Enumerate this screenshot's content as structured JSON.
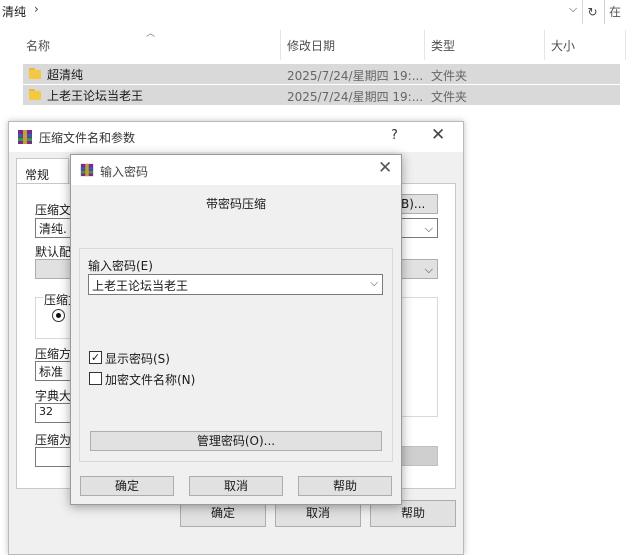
{
  "explorer": {
    "path": "清纯",
    "search_hint": "在",
    "columns": {
      "name": "名称",
      "modified": "修改日期",
      "type": "类型",
      "size": "大小"
    },
    "rows": [
      {
        "name": "超清纯",
        "modified": "2025/7/24/星期四 19:...",
        "type": "文件夹"
      },
      {
        "name": "上老王论坛当老王",
        "modified": "2025/7/24/星期四 19:...",
        "type": "文件夹"
      }
    ]
  },
  "back_dialog": {
    "title": "压缩文件名和参数",
    "help": "?",
    "tab": "常规",
    "archive_name_label": "压缩文",
    "archive_name_value": "清纯.",
    "browse_button_fragment": "B)...",
    "default_profile_label": "默认配",
    "format_group_label": "压缩文",
    "method_label": "压缩方",
    "method_value": "标准",
    "dict_label": "字典大",
    "dict_value": "32",
    "split_label": "压缩为",
    "ok_button": "确定",
    "cancel_button": "取消",
    "help_button": "帮助"
  },
  "password_dialog": {
    "title": "输入密码",
    "heading": "带密码压缩",
    "password_label": "输入密码(E)",
    "password_value": "上老王论坛当老王",
    "show_password_label": "显示密码(S)",
    "show_password_checked": true,
    "encrypt_names_label": "加密文件名称(N)",
    "encrypt_names_checked": false,
    "manage_button": "管理密码(O)...",
    "ok_button": "确定",
    "cancel_button": "取消",
    "help_button": "帮助"
  },
  "colors": {
    "folder": "#f5c842",
    "selected_row": "#d9d9d9",
    "dialog_bg": "#f0f0f0"
  }
}
